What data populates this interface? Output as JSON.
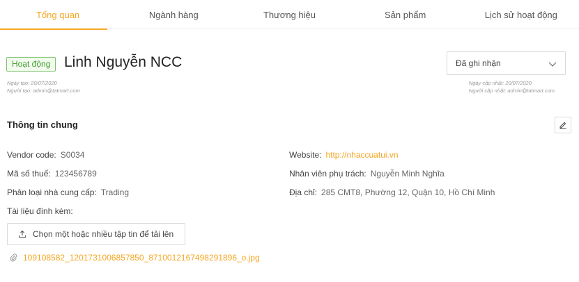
{
  "tabs": [
    {
      "label": "Tổng quan",
      "active": true
    },
    {
      "label": "Ngành hàng",
      "active": false
    },
    {
      "label": "Thương hiệu",
      "active": false
    },
    {
      "label": "Sản phẩm",
      "active": false
    },
    {
      "label": "Lịch sử hoạt động",
      "active": false
    }
  ],
  "header": {
    "status_badge": "Hoạt động",
    "vendor_name": "Linh Nguyễn NCC",
    "created_date": "Ngày tạo: 20/07/2020",
    "created_by": "Người tạo: admin@tatmart.com",
    "updated_date": "Ngày cập nhật: 20/07/2020",
    "updated_by": "Người cập nhật: admin@tatmart.com",
    "select_value": "Đã ghi nhận"
  },
  "section": {
    "title": "Thông tin chung"
  },
  "fields": {
    "vendor_code": {
      "label": "Vendor code:",
      "value": "S0034"
    },
    "tax_code": {
      "label": "Mã số thuế:",
      "value": "123456789"
    },
    "supplier_type": {
      "label": "Phân loại nhà cung cấp:",
      "value": "Trading"
    },
    "attachments": {
      "label": "Tài liệu đính kèm:"
    },
    "website": {
      "label": "Website:",
      "value": "http://nhaccuatui.vn"
    },
    "staff": {
      "label": "Nhân viên phụ trách:",
      "value": "Nguyễn Minh Nghĩa"
    },
    "address": {
      "label": "Địa chỉ:",
      "value": "285 CMT8, Phường 12, Quận 10, Hồ Chí Minh"
    }
  },
  "upload": {
    "label": "Chọn một hoặc nhiều tập tin để tải lên"
  },
  "file": {
    "name": "109108582_1201731006857850_8710012167498291896_o.jpg"
  },
  "colors": {
    "accent": "#f5a623",
    "success": "#3f9b2d"
  }
}
